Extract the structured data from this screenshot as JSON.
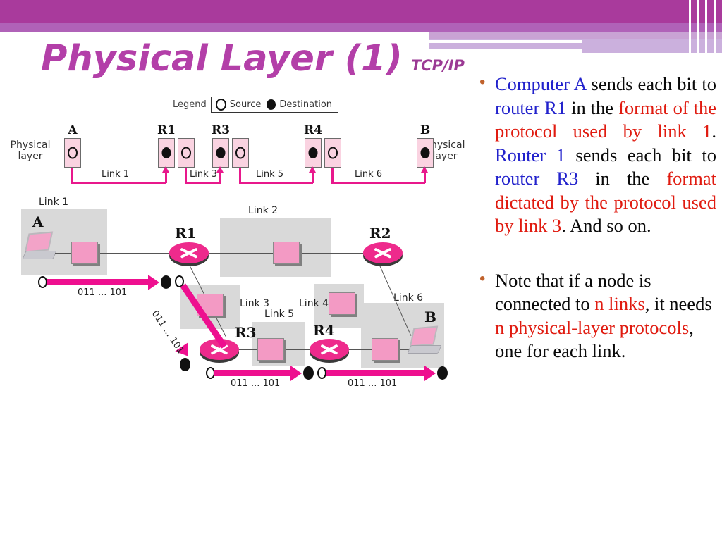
{
  "slide": {
    "title": "Physical Layer (1)",
    "subtitle": "TCP/IP"
  },
  "text_column": {
    "bullet_char": "•",
    "bullets": [
      {
        "id": "bullet-1",
        "plain": "Computer A sends each bit to router R1 in the format of the protocol used by link 1. Router 1 sends each bit to router R3 in the format dictated by the protocol used by link 3. And so on.",
        "runs": [
          {
            "t": "Computer A",
            "c": "blue"
          },
          {
            "t": " sends each bit to ",
            "c": "black"
          },
          {
            "t": "router R1",
            "c": "blue"
          },
          {
            "t": " in the ",
            "c": "black"
          },
          {
            "t": "format of the protocol used by link 1",
            "c": "red"
          },
          {
            "t": ". ",
            "c": "black"
          },
          {
            "t": "Router 1",
            "c": "blue"
          },
          {
            "t": " sends each bit to ",
            "c": "black"
          },
          {
            "t": "router R3",
            "c": "blue"
          },
          {
            "t": " in the ",
            "c": "black"
          },
          {
            "t": "format dictated by the protocol used by link 3",
            "c": "red"
          },
          {
            "t": ". And so on.",
            "c": "black"
          }
        ]
      },
      {
        "id": "bullet-2",
        "plain": "Note that if a node is connected to n links, it needs n physical-layer protocols, one for each link.",
        "runs": [
          {
            "t": "Note that if a node is connected to ",
            "c": "black"
          },
          {
            "t": "n links",
            "c": "red"
          },
          {
            "t": ", it needs ",
            "c": "black"
          },
          {
            "t": "n physical-layer protocols",
            "c": "red"
          },
          {
            "t": ", one for each link.",
            "c": "black"
          }
        ]
      }
    ]
  },
  "legend": {
    "label": "Legend",
    "source": "Source",
    "destination": "Destination"
  },
  "chain_diagram": {
    "physical_layer_label_left": "Physical\nlayer",
    "physical_layer_label_right": "Physical\nlayer",
    "nodes": [
      "A",
      "R1",
      "R3",
      "R4",
      "B"
    ],
    "links": [
      "Link 1",
      "Link 3",
      "Link 5",
      "Link 6"
    ]
  },
  "topology": {
    "routers": [
      "R1",
      "R2",
      "R3",
      "R4"
    ],
    "hosts": [
      "A",
      "B"
    ],
    "zones": [
      "Link 1",
      "Link 2",
      "Link 3",
      "Link 4",
      "Link 5",
      "Link 6"
    ],
    "bit_stream": "011 ... 101",
    "flows": [
      {
        "id": "flow-link1",
        "label": "011 ... 101"
      },
      {
        "id": "flow-link3",
        "label": "011 ... 101"
      },
      {
        "id": "flow-link5",
        "label": "011 ... 101"
      },
      {
        "id": "flow-link6",
        "label": "011 ... 101"
      }
    ]
  },
  "colors": {
    "banner_main": "#a93a9c",
    "banner_mid": "#b062b8",
    "banner_pale": "#cbb0dd",
    "title": "#b33fa8",
    "accent_pink": "#ee0f8f",
    "text_blue": "#2222cc",
    "text_red": "#e01b10"
  }
}
